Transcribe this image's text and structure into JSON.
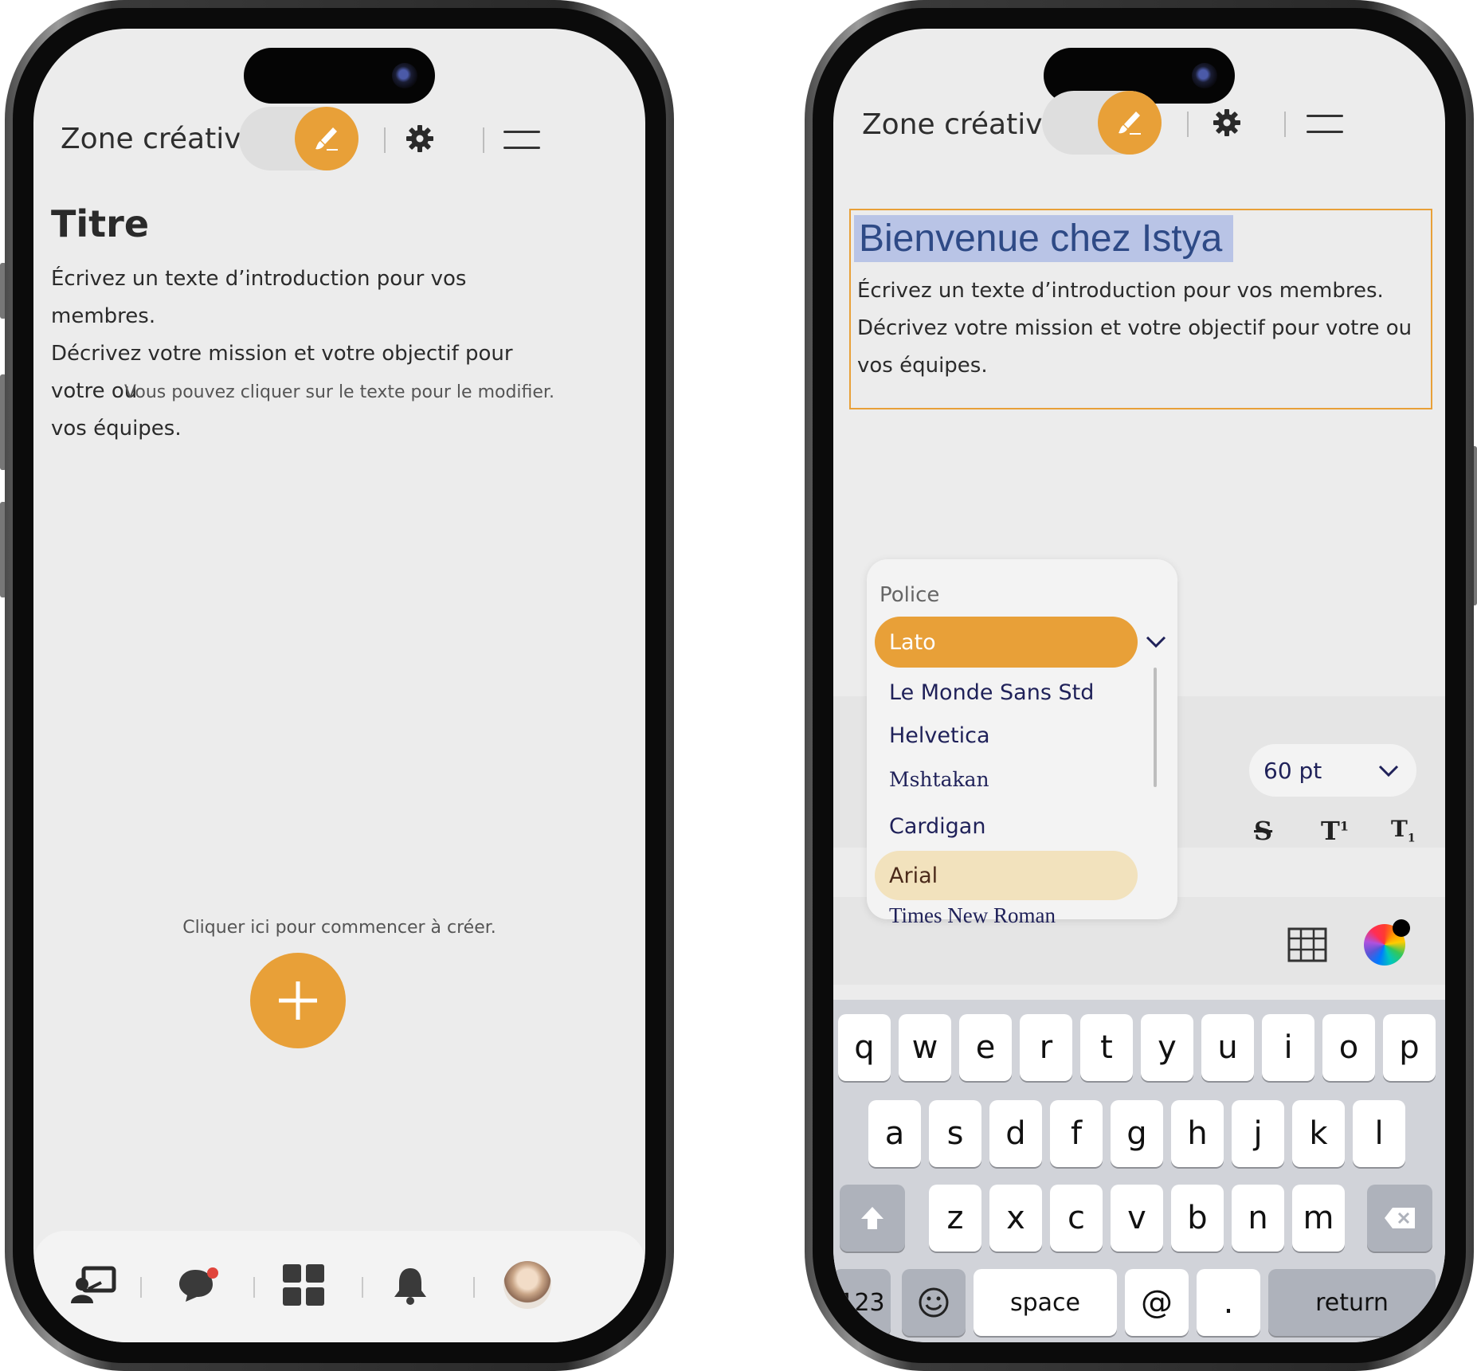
{
  "colors": {
    "accent": "#e8a038",
    "selection": "#b9c4e6",
    "text": "#2b2b2b",
    "navy": "#1f2159"
  },
  "left": {
    "header": {
      "title": "Zone créative"
    },
    "content": {
      "title": "Titre",
      "intro_lines": [
        "Écrivez un texte d’introduction pour vos membres.",
        "Décrivez votre mission et votre objectif pour votre ou",
        "vos équipes."
      ],
      "edit_hint": "Vous pouvez cliquer sur le texte pour le modifier.",
      "create_hint": "Cliquer ici pour commencer à créer."
    },
    "bottom_nav": [
      {
        "icon": "presentation-icon"
      },
      {
        "icon": "chat-bubble-icon",
        "badge": true
      },
      {
        "icon": "apps-grid-icon"
      },
      {
        "icon": "bell-icon"
      },
      {
        "icon": "profile-avatar"
      }
    ]
  },
  "right": {
    "header": {
      "title": "Zone créative"
    },
    "editor": {
      "selected_title": "Bienvenue chez Istya",
      "intro_lines": [
        "Écrivez un texte d’introduction pour vos membres.",
        "Décrivez votre mission et votre objectif pour votre ou",
        "vos équipes."
      ]
    },
    "font_dropdown": {
      "label": "Police",
      "selected": "Lato",
      "options": [
        "Le Monde Sans Std",
        "Helvetica",
        "Mshtakan",
        "Cardigan",
        "Arial",
        "Times New Roman"
      ],
      "highlighted": "Arial"
    },
    "size_select": {
      "value": "60 pt"
    },
    "keyboard": {
      "row1": [
        "q",
        "w",
        "e",
        "r",
        "t",
        "y",
        "u",
        "i",
        "o",
        "p"
      ],
      "row2": [
        "a",
        "s",
        "d",
        "f",
        "g",
        "h",
        "j",
        "k",
        "l"
      ],
      "row3": [
        "z",
        "x",
        "c",
        "v",
        "b",
        "n",
        "m"
      ],
      "num_key": "123",
      "space_key": "space",
      "at_key": "@",
      "dot_key": ".",
      "return_key": "return"
    }
  }
}
